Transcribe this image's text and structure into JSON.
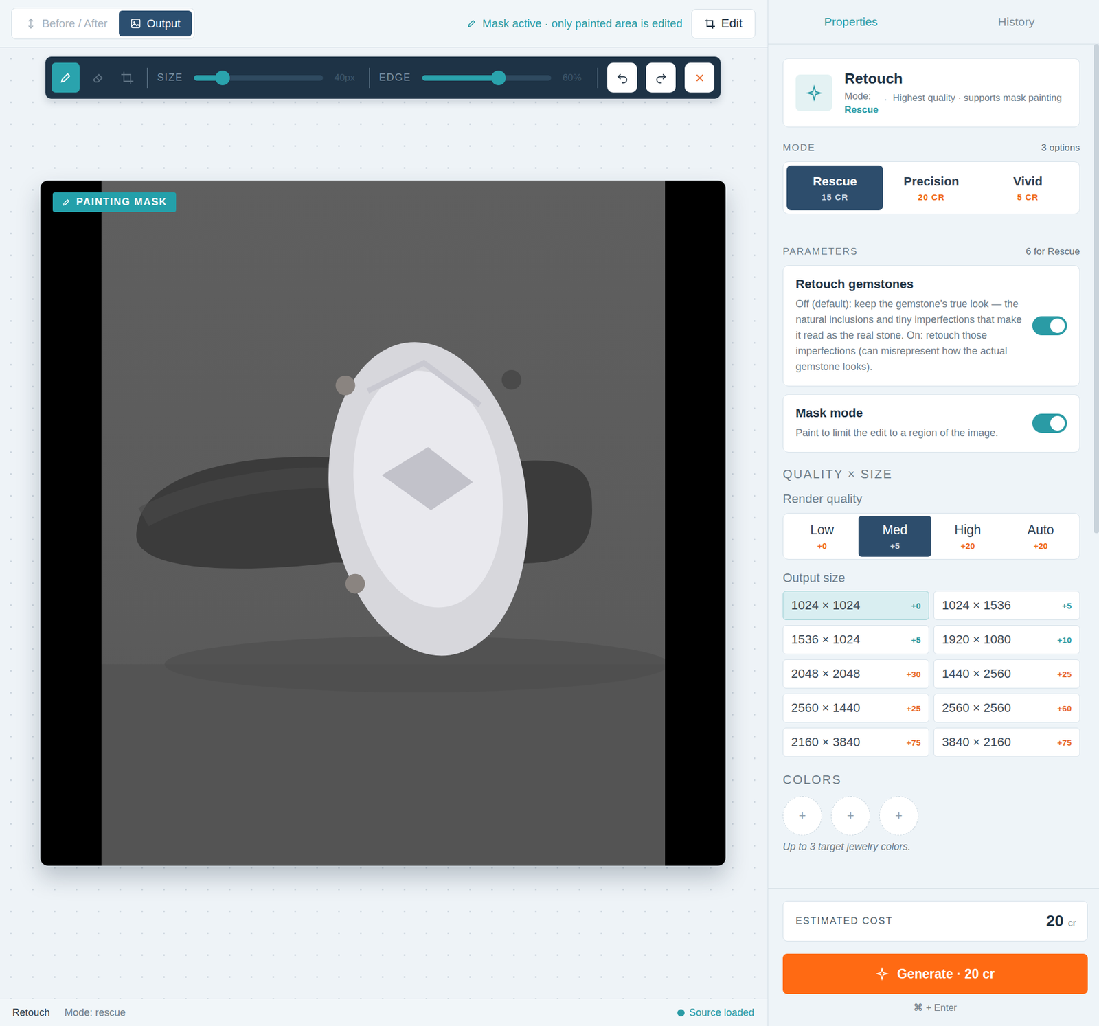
{
  "top_bar": {
    "view_toggle": [
      {
        "label": "Before / After",
        "kind": "compare",
        "selected": false
      },
      {
        "label": "Output",
        "kind": "image",
        "selected": true
      }
    ],
    "mask_notice": "Mask active · only painted area is edited",
    "edit_button": "Edit"
  },
  "toolbar": {
    "tools": [
      {
        "kind": "brush",
        "selected": true
      },
      {
        "kind": "eraser",
        "selected": false
      },
      {
        "kind": "crop",
        "selected": false
      }
    ],
    "sliders": [
      {
        "label": "SIZE",
        "level": 0.22,
        "reading": "40px"
      },
      {
        "label": "EDGE",
        "level": 0.59,
        "reading": "60%"
      }
    ]
  },
  "canvas": {
    "badge": "PAINTING MASK"
  },
  "status_bar": {
    "tool": "Retouch",
    "mode": "Mode: rescue",
    "status": "Source loaded"
  },
  "panel": {
    "tabs": [
      {
        "label": "Properties",
        "selected": true
      },
      {
        "label": "History",
        "selected": false
      }
    ],
    "tool_card": {
      "title": "Retouch",
      "mode_label": "Mode:",
      "mode_value": "Rescue",
      "separator": "·",
      "description": "Highest quality · supports mask painting"
    },
    "mode": {
      "label": "MODE",
      "count": "3 options",
      "options": [
        {
          "label": "Rescue",
          "cost": "15 CR",
          "selected": true
        },
        {
          "label": "Precision",
          "cost": "20 CR",
          "selected": false
        },
        {
          "label": "Vivid",
          "cost": "5 CR",
          "selected": false
        }
      ]
    },
    "parameters": {
      "label": "PARAMETERS",
      "count": "6 for Rescue",
      "toggles": [
        {
          "title": "Retouch gemstones",
          "description": "Off (default): keep the gemstone's true look — the natural inclusions and tiny imperfections that make it read as the real stone. On: retouch those imperfections (can misrepresent how the actual gemstone looks).",
          "on": true
        },
        {
          "title": "Mask mode",
          "description": "Paint to limit the edit to a region of the image.",
          "on": true
        }
      ]
    },
    "quality_size": {
      "heading": "QUALITY × SIZE",
      "render_quality": {
        "label": "Render quality",
        "options": [
          {
            "label": "Low",
            "cost": "+0",
            "selected": false
          },
          {
            "label": "Med",
            "cost": "+5",
            "selected": true
          },
          {
            "label": "High",
            "cost": "+20",
            "selected": false
          },
          {
            "label": "Auto",
            "cost": "+20",
            "selected": false
          }
        ]
      },
      "output_size": {
        "label": "Output size",
        "options": [
          {
            "label": "1024 × 1024",
            "cost": "+0",
            "color": "#2a9ba5",
            "selected": true
          },
          {
            "label": "1024 × 1536",
            "cost": "+5",
            "color": "#2a9ba5",
            "selected": false
          },
          {
            "label": "1536 × 1024",
            "cost": "+5",
            "color": "#2a9ba5",
            "selected": false
          },
          {
            "label": "1920 × 1080",
            "cost": "+10",
            "color": "#2a9ba5",
            "selected": false
          },
          {
            "label": "2048 × 2048",
            "cost": "+30",
            "color": "#e8692a",
            "selected": false
          },
          {
            "label": "1440 × 2560",
            "cost": "+25",
            "color": "#e8692a",
            "selected": false
          },
          {
            "label": "2560 × 1440",
            "cost": "+25",
            "color": "#e8692a",
            "selected": false
          },
          {
            "label": "2560 × 2560",
            "cost": "+60",
            "color": "#e8692a",
            "selected": false
          },
          {
            "label": "2160 × 3840",
            "cost": "+75",
            "color": "#e8692a",
            "selected": false
          },
          {
            "label": "3840 × 2160",
            "cost": "+75",
            "color": "#e8692a",
            "selected": false
          }
        ]
      }
    },
    "colors": {
      "heading": "COLORS",
      "slots": [
        "+",
        "+",
        "+"
      ],
      "hint": "Up to 3 target jewelry colors."
    },
    "footer": {
      "cost_label": "ESTIMATED COST",
      "cost_value": "20",
      "cost_unit": "cr",
      "generate": "Generate · 20 cr",
      "shortcut": "⌘ + Enter"
    }
  }
}
